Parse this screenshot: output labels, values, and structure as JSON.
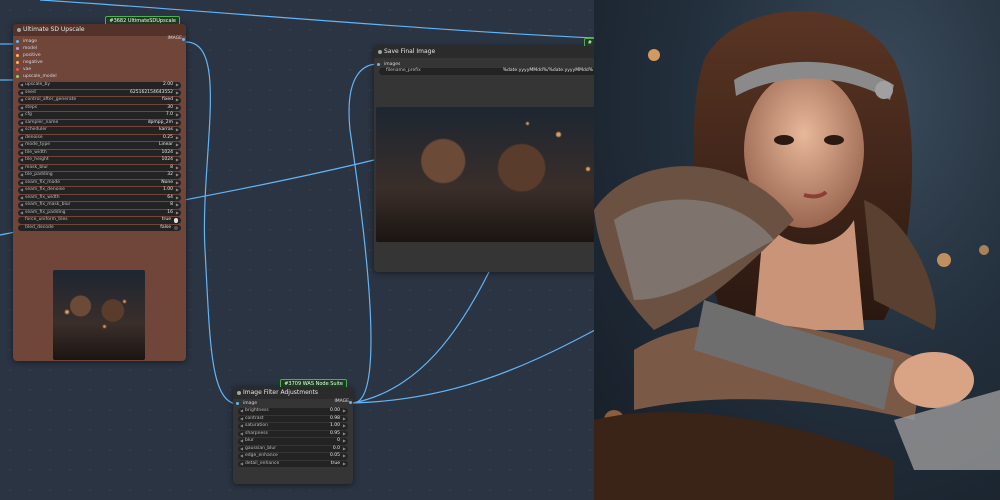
{
  "upscale_node": {
    "badge": "#3682 UltimateSDUpscale",
    "title": "Ultimate SD Upscale",
    "inputs": [
      "image",
      "model",
      "positive",
      "negative",
      "vae",
      "upscale_model"
    ],
    "output": "IMAGE",
    "widgets": [
      {
        "label": "upscale_by",
        "value": "2.00"
      },
      {
        "label": "seed",
        "value": "625162154643552"
      },
      {
        "label": "control_after_generate",
        "value": "fixed"
      },
      {
        "label": "steps",
        "value": "30"
      },
      {
        "label": "cfg",
        "value": "7.0"
      },
      {
        "label": "sampler_name",
        "value": "dpmpp_2m"
      },
      {
        "label": "scheduler",
        "value": "karras"
      },
      {
        "label": "denoise",
        "value": "0.25"
      },
      {
        "label": "mode_type",
        "value": "Linear"
      },
      {
        "label": "tile_width",
        "value": "1024"
      },
      {
        "label": "tile_height",
        "value": "1024"
      },
      {
        "label": "mask_blur",
        "value": "8"
      },
      {
        "label": "tile_padding",
        "value": "32"
      },
      {
        "label": "seam_fix_mode",
        "value": "None"
      },
      {
        "label": "seam_fix_denoise",
        "value": "1.00"
      },
      {
        "label": "seam_fix_width",
        "value": "64"
      },
      {
        "label": "seam_fix_mask_blur",
        "value": "8"
      },
      {
        "label": "seam_fix_padding",
        "value": "16"
      }
    ],
    "toggles": [
      {
        "label": "force_uniform_tiles",
        "value": "true"
      },
      {
        "label": "tiled_decode",
        "value": "false"
      }
    ]
  },
  "save_node": {
    "badge": "#",
    "title": "Save Final Image",
    "input": "images",
    "prefix_label": "filename_prefix",
    "prefix_value": "%date:yyyyMMdd%/%date:yyyyMMdd%"
  },
  "filter_node": {
    "badge": "#3709 WAS Node Suite",
    "title": "Image Filter Adjustments",
    "input": "image",
    "output": "IMAGE",
    "widgets": [
      {
        "label": "brightness",
        "value": "0.00"
      },
      {
        "label": "contrast",
        "value": "0.98"
      },
      {
        "label": "saturation",
        "value": "1.00"
      },
      {
        "label": "sharpness",
        "value": "0.95"
      },
      {
        "label": "blur",
        "value": "0"
      },
      {
        "label": "gaussian_blur",
        "value": "0.0"
      },
      {
        "label": "edge_enhance",
        "value": "0.05"
      }
    ],
    "last_widget": {
      "label": "detail_enhance",
      "value": "true"
    }
  },
  "colors": {
    "canvas": "#2a3442",
    "upscale_node": "#70453a",
    "node_body": "#353535",
    "wire": "#64b5f6",
    "badge_border": "#4caf50"
  }
}
